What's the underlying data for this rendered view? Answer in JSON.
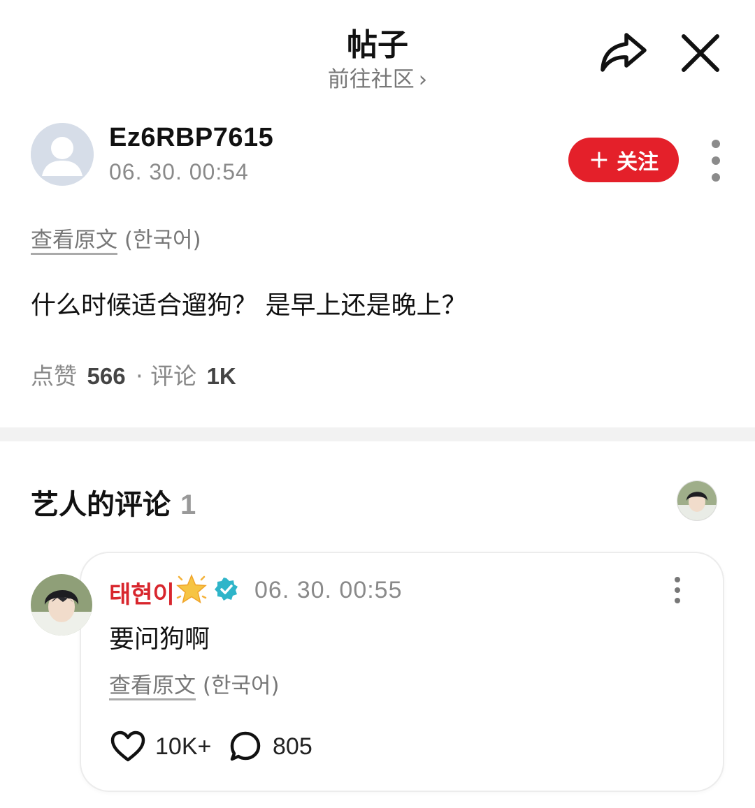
{
  "header": {
    "title": "帖子",
    "community_link": "前往社区",
    "chevron": "›",
    "icons": [
      "share-icon",
      "close-icon"
    ]
  },
  "post": {
    "author_name": "Ez6RBP7615",
    "timestamp": "06. 30. 00:54",
    "follow_plus": "+",
    "follow_label": "关注",
    "view_original": "查看原文",
    "original_language": "(한국어)",
    "body": "什么时候适合遛狗？ 是早上还是晚上？",
    "likes_label": "点赞",
    "likes_count": "566",
    "separator": "·",
    "comments_label": "评论",
    "comments_count": "1K"
  },
  "artist_comments": {
    "title": "艺人的评论",
    "count": "1",
    "comment": {
      "author_name": "태현이",
      "timestamp": "06. 30. 00:55",
      "body": "要问狗啊",
      "view_original": "查看原文",
      "original_language": "(한국어)",
      "like_count": "10K+",
      "reply_count": "805",
      "icons": [
        "star-icon",
        "verified-icon",
        "heart-icon",
        "reply-bubble-icon"
      ]
    }
  },
  "colors": {
    "accent_red": "#e4202a",
    "artist_name": "#d8262d",
    "verified": "#2fb5c9",
    "divider": "#f2f2f2"
  }
}
